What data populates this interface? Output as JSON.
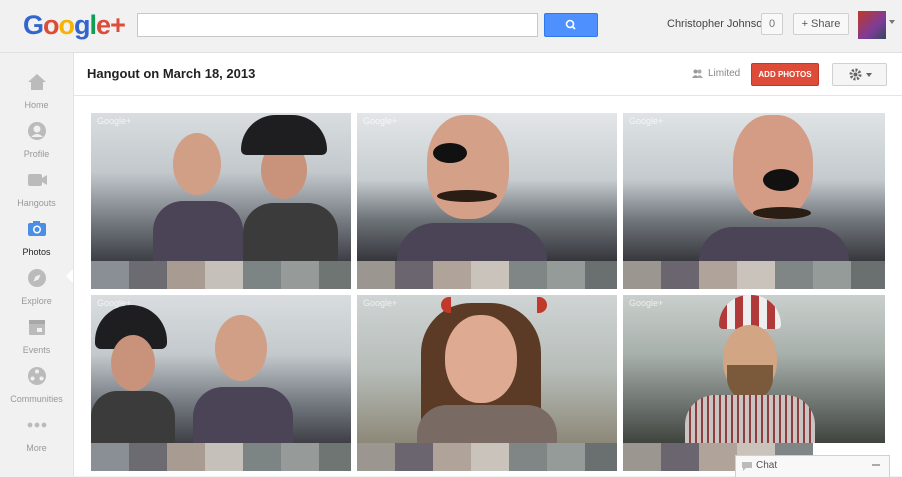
{
  "header": {
    "logo_text": "Google+",
    "search": {
      "placeholder": "",
      "value": ""
    },
    "user_name": "Christopher Johnson",
    "notification_count": "0",
    "share_label": "+ Share"
  },
  "sidebar": {
    "items": [
      {
        "label": "Home",
        "icon": "home-icon"
      },
      {
        "label": "Profile",
        "icon": "profile-icon"
      },
      {
        "label": "Hangouts",
        "icon": "hangouts-icon"
      },
      {
        "label": "Photos",
        "icon": "photos-icon",
        "active": true
      },
      {
        "label": "Explore",
        "icon": "explore-icon"
      },
      {
        "label": "Events",
        "icon": "events-icon"
      },
      {
        "label": "Communities",
        "icon": "communities-icon"
      },
      {
        "label": "More",
        "icon": "more-icon"
      }
    ]
  },
  "album": {
    "title": "Hangout on March 18, 2013",
    "visibility": "Limited",
    "add_photos_label": "ADD PHOTOS",
    "watermark": "Google+"
  },
  "chat": {
    "label": "Chat"
  },
  "colors": {
    "accent_blue": "#4d90fe",
    "add_photos_red": "#dd4b39",
    "logo_blue": "#3366cc",
    "logo_red": "#dd4b39",
    "logo_yellow": "#f4b400",
    "logo_green": "#0f9d58"
  }
}
